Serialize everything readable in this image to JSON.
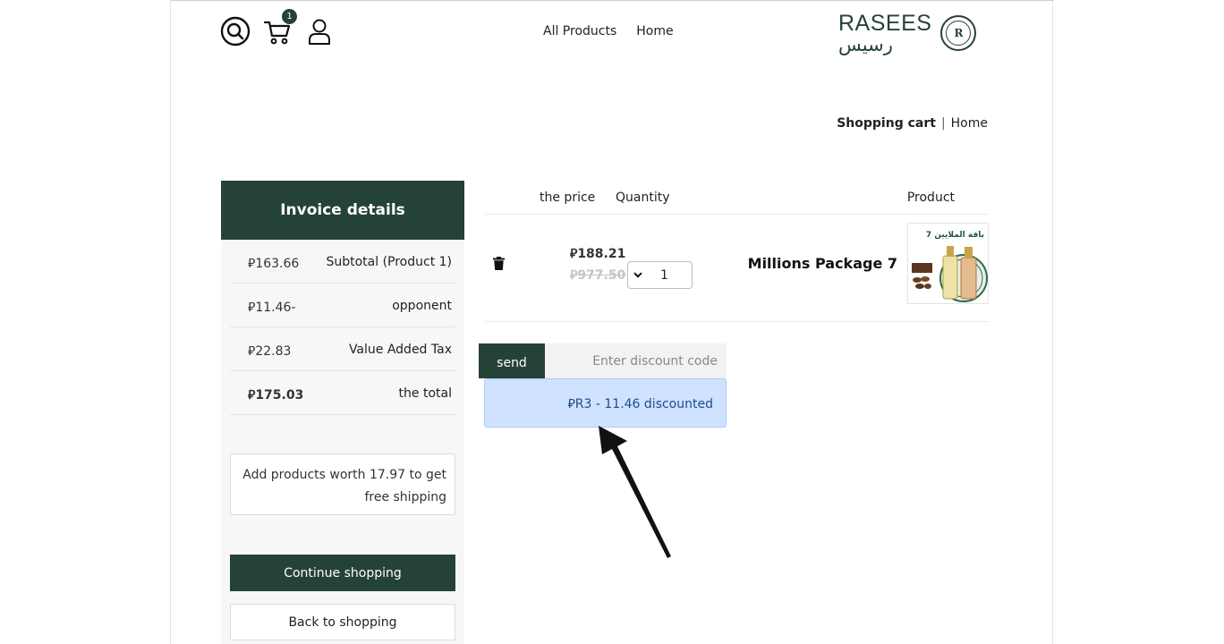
{
  "header": {
    "cart_count": "1",
    "nav": {
      "all_products": "All Products",
      "home": "Home"
    },
    "logo": {
      "latin": "RASEES",
      "arabic": "رسيس",
      "seal": "R"
    }
  },
  "breadcrumb": {
    "current": "Shopping cart",
    "separator": "|",
    "home": "Home"
  },
  "invoice": {
    "title": "Invoice details",
    "rows": [
      {
        "label": "Subtotal (Product 1)",
        "amount": "⃁163.66"
      },
      {
        "label": "opponent",
        "amount": "⃁11.46-"
      },
      {
        "label": "Value Added Tax",
        "amount": "⃁22.83"
      },
      {
        "label": "the total",
        "amount": "⃁175.03"
      }
    ],
    "shipping_note": "Add products worth 17.97 to get free shipping",
    "continue_label": "Continue shopping",
    "back_label": "Back to shopping"
  },
  "cart": {
    "headers": {
      "price": "the price",
      "quantity": "Quantity",
      "product": "Product"
    },
    "items": [
      {
        "name": "Millions Package 7",
        "price_now": "⃁188.21",
        "price_old": "⃁977.50",
        "quantity": "1",
        "image_caption": "باقة الملايين 7"
      }
    ]
  },
  "discount": {
    "send_label": "send",
    "placeholder": "Enter discount code",
    "message": "⃁R3 - 11.46 discounted"
  },
  "colors": {
    "brand": "#254236",
    "alert_bg": "#cfe2ff",
    "alert_text": "#1d4b8f"
  },
  "icons": [
    "search-icon",
    "cart-icon",
    "user-icon",
    "trash-icon",
    "chevron-down-icon",
    "arrow-annotation"
  ]
}
